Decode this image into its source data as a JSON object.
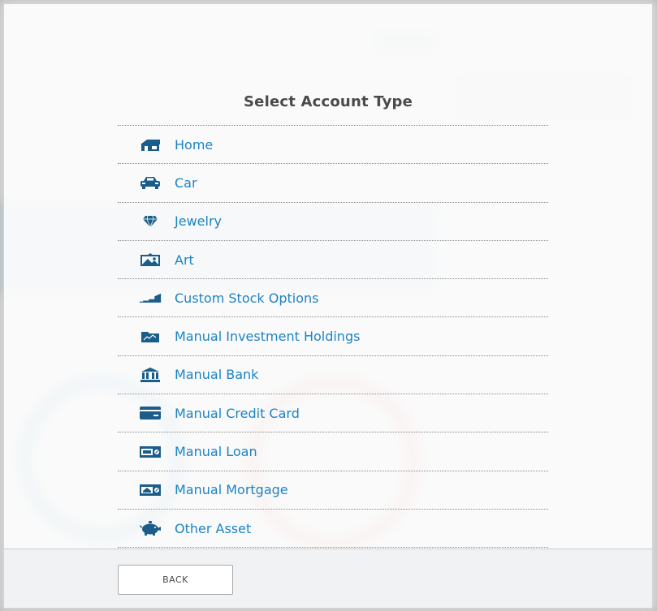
{
  "modal": {
    "title": "Select Account Type",
    "account_types": [
      {
        "label": "Home",
        "icon": "home-icon"
      },
      {
        "label": "Car",
        "icon": "car-icon"
      },
      {
        "label": "Jewelry",
        "icon": "jewelry-icon"
      },
      {
        "label": "Art",
        "icon": "art-icon"
      },
      {
        "label": "Custom Stock Options",
        "icon": "stock-options-icon"
      },
      {
        "label": "Manual Investment Holdings",
        "icon": "investment-folder-icon"
      },
      {
        "label": "Manual Bank",
        "icon": "bank-icon"
      },
      {
        "label": "Manual Credit Card",
        "icon": "credit-card-icon"
      },
      {
        "label": "Manual Loan",
        "icon": "loan-icon"
      },
      {
        "label": "Manual Mortgage",
        "icon": "mortgage-icon"
      },
      {
        "label": "Other Asset",
        "icon": "piggy-bank-icon"
      }
    ],
    "back_label": "BACK"
  },
  "colors": {
    "accent": "#1b84c4",
    "icon": "#1a5c8a",
    "title": "#4a4a4a"
  }
}
